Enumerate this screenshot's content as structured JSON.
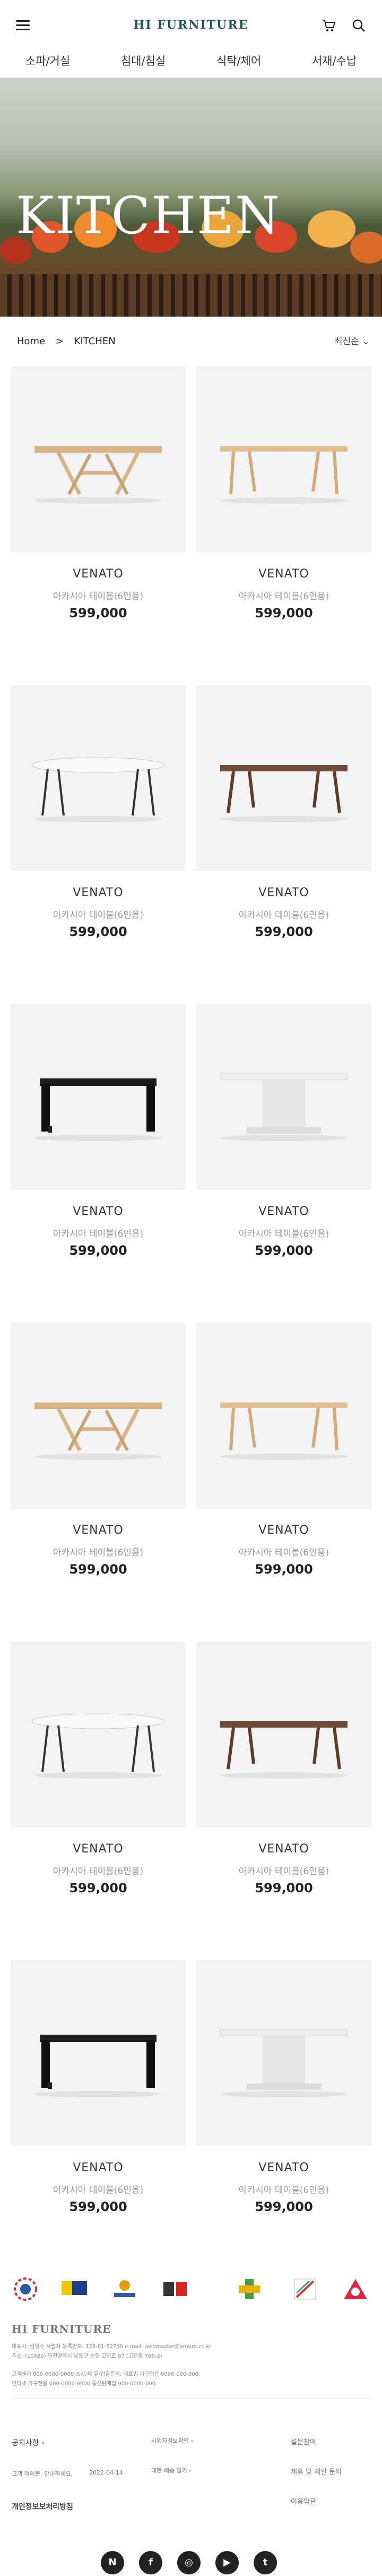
{
  "header": {
    "logo": "HI FURNITURE"
  },
  "nav": [
    "소파/거실",
    "침대/침실",
    "식탁/체어",
    "서재/수납"
  ],
  "hero": {
    "title": "KITCHEN"
  },
  "breadcrumb": {
    "home": "Home",
    "sep": ">",
    "current": "KITCHEN"
  },
  "sort": {
    "label": "최신순"
  },
  "products": [
    {
      "name": "VENATO",
      "desc": "아카시아 테이블(6인용)",
      "price": "599,000",
      "kind": "wood-x"
    },
    {
      "name": "VENATO",
      "desc": "아카시아 테이블(6인용)",
      "price": "599,000",
      "kind": "wood-light"
    },
    {
      "name": "VENATO",
      "desc": "아카시아 테이블(6인용)",
      "price": "599,000",
      "kind": "white-oval"
    },
    {
      "name": "VENATO",
      "desc": "아카시아 테이블(6인용)",
      "price": "599,000",
      "kind": "dark-wood"
    },
    {
      "name": "VENATO",
      "desc": "아카시아 테이블(6인용)",
      "price": "599,000",
      "kind": "black"
    },
    {
      "name": "VENATO",
      "desc": "아카시아 테이블(6인용)",
      "price": "599,000",
      "kind": "white-pedestal"
    },
    {
      "name": "VENATO",
      "desc": "아카시아 테이블(6인용)",
      "price": "599,000",
      "kind": "wood-x"
    },
    {
      "name": "VENATO",
      "desc": "아카시아 테이블(6인용)",
      "price": "599,000",
      "kind": "wood-light"
    },
    {
      "name": "VENATO",
      "desc": "아카시아 테이블(6인용)",
      "price": "599,000",
      "kind": "white-oval"
    },
    {
      "name": "VENATO",
      "desc": "아카시아 테이블(6인용)",
      "price": "599,000",
      "kind": "dark-wood"
    },
    {
      "name": "VENATO",
      "desc": "아카시아 테이블(6인용)",
      "price": "599,000",
      "kind": "black"
    },
    {
      "name": "VENATO",
      "desc": "아카시아 테이블(6인용)",
      "price": "599,000",
      "kind": "white-pedestal"
    }
  ],
  "footer": {
    "logo": "HI FURNITURE",
    "info1": "대표자: 김영수     사업자 등록번호: 128-81-52760 e-mail: webmaster@amuro.co.kr",
    "info2": "주소: (10480) 인천광역시 남동구 논현 고잔로 87 (고잔동 766-3)",
    "info3": "고객센터 000-0000-0000 소싱/제 휴/입점문의: 대표번 가구전용 0000-000-000,",
    "info4": "인터넷 가구전용 000-0000-0000 통신판매업 000-0000-000",
    "notice_label": "공지사항",
    "notice_text": "고객 여러분, 안내하세요.",
    "notice_date": "2022-04-14",
    "privacy": "개인정보보처리방침",
    "link1": "사업자정보확인",
    "link2": "대한 배송 알기",
    "link3": "설문참여",
    "link4": "제휴 및 제안 문의",
    "link5": "이용약관",
    "social": [
      "N",
      "f",
      "◎",
      "▶",
      "t"
    ]
  }
}
